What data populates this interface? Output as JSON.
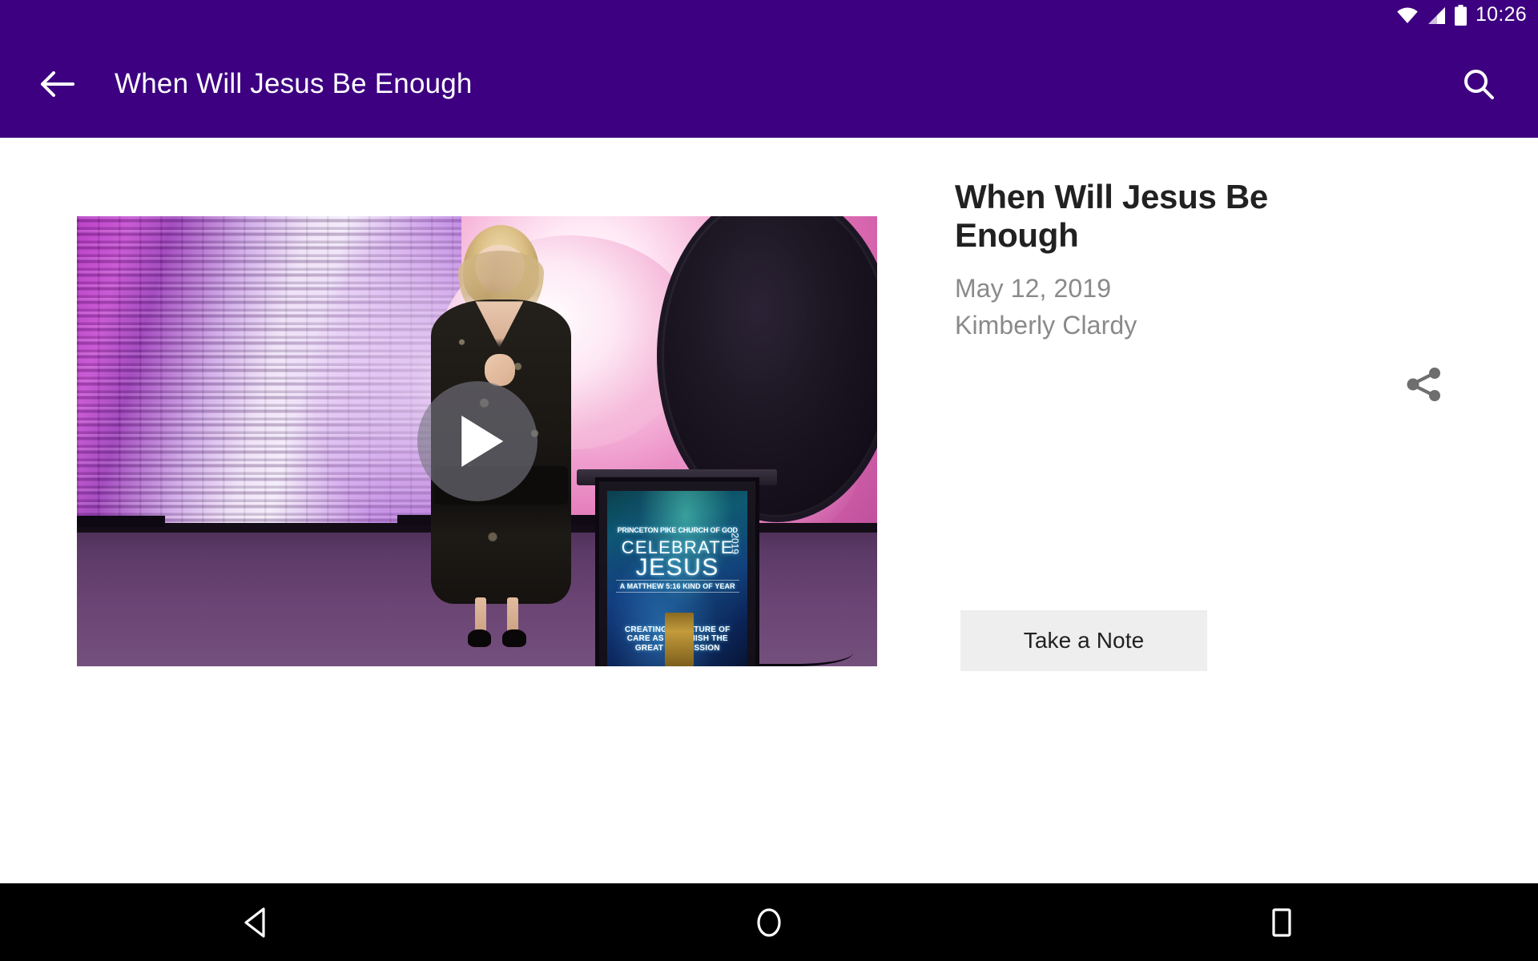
{
  "status_bar": {
    "time": "10:26",
    "icons": [
      "wifi-icon",
      "cellular-signal-icon",
      "battery-icon"
    ]
  },
  "app_bar": {
    "back_icon": "arrow-back-icon",
    "title": "When Will Jesus Be Enough",
    "search_icon": "search-icon",
    "background_color": "#3d0080"
  },
  "video": {
    "play_icon": "play-icon",
    "alt": "Woman speaking on stage in front of purple-lit brick wall with floral backdrop",
    "podium_screen": {
      "church": "PRINCETON PIKE CHURCH OF GOD",
      "headline_1": "CELEBRATE",
      "headline_2": "JESUS",
      "year": "2019",
      "tagline": "A MATTHEW 5:16 KIND OF YEAR",
      "mission": "CREATING A CULTURE OF CARE AS WE FINISH THE GREAT COMMISSION"
    }
  },
  "details": {
    "title": "When Will Jesus Be Enough",
    "date": "May 12, 2019",
    "speaker": "Kimberly Clardy",
    "share_icon": "share-icon",
    "take_note_label": "Take a Note",
    "title_color": "#212121",
    "meta_color": "#8a8a8a",
    "button_color": "#eeeeef"
  },
  "nav_bar": {
    "back_icon": "triangle-back-icon",
    "home_icon": "circle-home-icon",
    "recents_icon": "square-recents-icon"
  }
}
